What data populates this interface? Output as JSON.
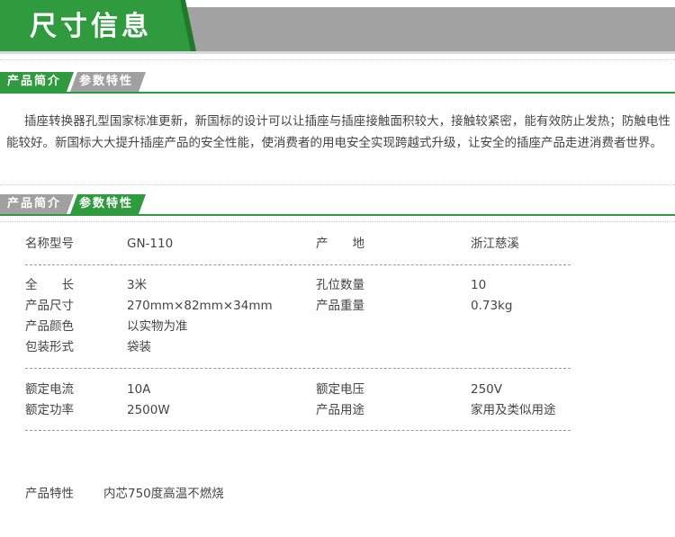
{
  "banner": {
    "title": "尺寸信息"
  },
  "tabs": {
    "intro": "产品简介",
    "params": "参数特性"
  },
  "intro_text": "插座转换器孔型国家标准更新，新国标的设计可以让插座与插座接触面积较大，接触较紧密，能有效防止发热；防触电性能较好。新国标大大提升插座产品的安全性能，使消费者的用电安全实现跨越式升级，让安全的插座产品走进消费者世界。",
  "specs": {
    "name_label": "名称型号",
    "name_value": "GN-110",
    "origin_label": "产　　地",
    "origin_value": "浙江慈溪",
    "length_label": "全　　长",
    "length_value": "3米",
    "holes_label": "孔位数量",
    "holes_value": "10",
    "size_label": "产品尺寸",
    "size_value": "270mm×82mm×34mm",
    "weight_label": "产品重量",
    "weight_value": "0.73kg",
    "color_label": "产品颜色",
    "color_value": "以实物为准",
    "pack_label": "包装形式",
    "pack_value": "袋装",
    "current_label": "额定电流",
    "current_value": "10A",
    "voltage_label": "额定电压",
    "voltage_value": "250V",
    "power_label": "额定功率",
    "power_value": "2500W",
    "use_label": "产品用途",
    "use_value": "家用及类似用途"
  },
  "feature": {
    "label": "产品特性",
    "value": "内芯750度高温不燃烧"
  },
  "colors": {
    "green": "#2f9a3e",
    "gray": "#a3a3a3"
  }
}
